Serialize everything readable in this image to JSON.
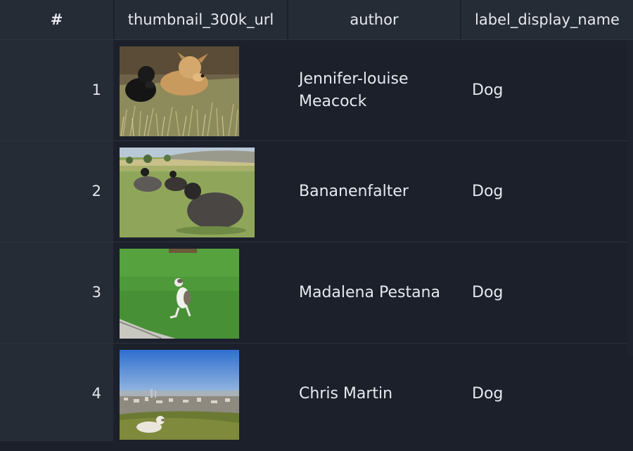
{
  "table": {
    "columns": {
      "index": "#",
      "thumbnail": "thumbnail_300k_url",
      "author": "author",
      "label": "label_display_name"
    },
    "rows": [
      {
        "index": "1",
        "thumbnail_icon": "two-dogs-lying-in-grass-photo",
        "author": "Jennifer-louise Meacock",
        "label": "Dog"
      },
      {
        "index": "2",
        "thumbnail_icon": "black-sheep-on-meadow-photo",
        "author": "Bananenfalter",
        "label": "Dog"
      },
      {
        "index": "3",
        "thumbnail_icon": "greyhound-sitting-on-lawn-photo",
        "author": "Madalena Pestana",
        "label": "Dog"
      },
      {
        "index": "4",
        "thumbnail_icon": "dog-on-hill-above-city-photo",
        "author": "Chris Martin",
        "label": "Dog"
      }
    ]
  }
}
